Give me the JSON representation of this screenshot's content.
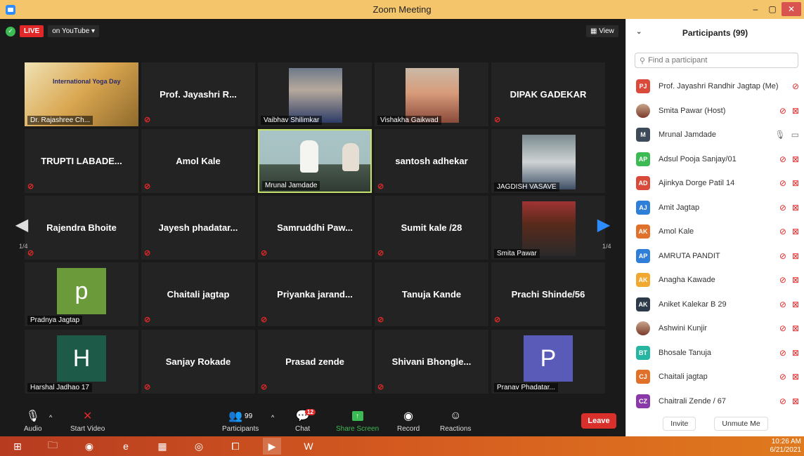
{
  "window": {
    "title": "Zoom Meeting",
    "min": "–",
    "max": "▢",
    "close": "✕"
  },
  "live": {
    "live_label": "LIVE",
    "platform_label": "on YouTube ▾"
  },
  "view_label": "▦ View",
  "pagination": {
    "left": "1/4",
    "right": "1/4"
  },
  "tiles": [
    {
      "name": "Dr. Rajashree Ch...",
      "kind": "poster",
      "poster_title": "International Yoga Day"
    },
    {
      "name": "Prof. Jayashri R...",
      "kind": "name"
    },
    {
      "name": "Vaibhav Shilimkar",
      "kind": "photo"
    },
    {
      "name": "Vishakha Gaikwad",
      "kind": "photo"
    },
    {
      "name": "DIPAK GADEKAR",
      "kind": "name"
    },
    {
      "name": "TRUPTI LABADE...",
      "kind": "name"
    },
    {
      "name": "Amol Kale",
      "kind": "name"
    },
    {
      "name": "Mrunal Jamdade",
      "kind": "video"
    },
    {
      "name": "santosh adhekar",
      "kind": "name"
    },
    {
      "name": "JAGDISH VASAVE",
      "kind": "photo"
    },
    {
      "name": "Rajendra Bhoite",
      "kind": "name"
    },
    {
      "name": "Jayesh phadatar...",
      "kind": "name"
    },
    {
      "name": "Samruddhi Paw...",
      "kind": "name"
    },
    {
      "name": "Sumit kale /28",
      "kind": "name"
    },
    {
      "name": "Smita Pawar",
      "kind": "photo"
    },
    {
      "name": "Pradnya Jagtap",
      "kind": "letter",
      "letter": "p"
    },
    {
      "name": "Chaitali jagtap",
      "kind": "name"
    },
    {
      "name": "Priyanka jarand...",
      "kind": "name"
    },
    {
      "name": "Tanuja Kande",
      "kind": "name"
    },
    {
      "name": "Prachi Shinde/56",
      "kind": "name"
    },
    {
      "name": "Harshal Jadhao 17",
      "kind": "letter",
      "letter": "H"
    },
    {
      "name": "Sanjay Rokade",
      "kind": "name"
    },
    {
      "name": "Prasad zende",
      "kind": "name"
    },
    {
      "name": "Shivani Bhongle...",
      "kind": "name"
    },
    {
      "name": "Pranav Phadatar...",
      "kind": "letter",
      "letter": "P"
    }
  ],
  "toolbar": {
    "audio": "Audio",
    "start_video": "Start Video",
    "participants": "Participants",
    "participants_count": "99",
    "chat": "Chat",
    "chat_badge": "12",
    "share_screen": "Share Screen",
    "record": "Record",
    "reactions": "Reactions",
    "leave": "Leave"
  },
  "panel": {
    "title": "Participants (99)",
    "search_placeholder": "Find a participant",
    "invite": "Invite",
    "unmute_me": "Unmute Me",
    "participants": [
      {
        "initials": "PJ",
        "name": "Prof. Jayashri Randhir Jagtap (Me)",
        "color": "#d94a3a"
      },
      {
        "initials": "",
        "name": "Smita Pawar (Host)",
        "color": "photo"
      },
      {
        "initials": "M",
        "name": "Mrunal Jamdade",
        "color": "#3d4a5a"
      },
      {
        "initials": "AP",
        "name": "Adsul Pooja Sanjay/01",
        "color": "#3cba54"
      },
      {
        "initials": "AD",
        "name": "Ajinkya Dorge Patil 14",
        "color": "#d94a3a"
      },
      {
        "initials": "AJ",
        "name": "Amit Jagtap",
        "color": "#2f7fd8"
      },
      {
        "initials": "AK",
        "name": "Amol Kale",
        "color": "#e0702a"
      },
      {
        "initials": "AP",
        "name": "AMRUTA PANDIT",
        "color": "#2f7fd8"
      },
      {
        "initials": "AK",
        "name": "Anagha Kawade",
        "color": "#f0a830"
      },
      {
        "initials": "AK",
        "name": "Aniket Kalekar B 29",
        "color": "#2d3a4a"
      },
      {
        "initials": "",
        "name": "Ashwini Kunjir",
        "color": "photo"
      },
      {
        "initials": "BT",
        "name": "Bhosale Tanuja",
        "color": "#26b5a0"
      },
      {
        "initials": "CJ",
        "name": "Chaitali jagtap",
        "color": "#e0702a"
      },
      {
        "initials": "CZ",
        "name": "Chaitrali Zende / 67",
        "color": "#8a3aa8"
      }
    ]
  },
  "taskbar": {
    "time": "10:26 AM",
    "date": "6/21/2021"
  }
}
